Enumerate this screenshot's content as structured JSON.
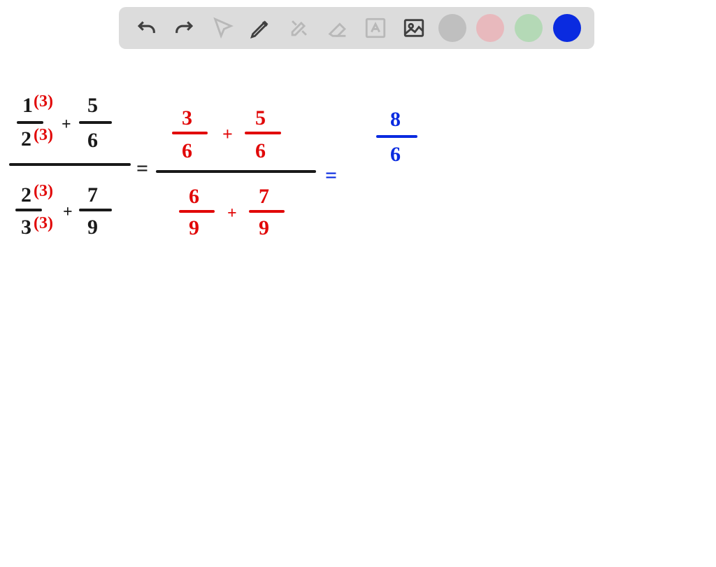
{
  "toolbar": {
    "tools": {
      "undo": "undo",
      "redo": "redo",
      "pointer": "pointer",
      "pen": "pen",
      "tools_disabled": "tools",
      "eraser": "eraser",
      "textbox": "text",
      "image": "image"
    },
    "colors": {
      "gray": "#bfbfbf",
      "pink": "#e8b9bd",
      "green": "#b4d9b6",
      "blue": "#0a2be0"
    }
  },
  "math": {
    "colors": {
      "black": "#1a1a1a",
      "red": "#e10808",
      "blue": "#0a2be0"
    },
    "step1": {
      "top": {
        "frac1": {
          "num": "1",
          "den": "2",
          "mult_num": "(3)",
          "mult_den": "(3)"
        },
        "plus": "+",
        "frac2": {
          "num": "5",
          "den": "6"
        }
      },
      "bottom": {
        "frac1": {
          "num": "2",
          "den": "3",
          "mult_num": "(3)",
          "mult_den": "(3)"
        },
        "plus": "+",
        "frac2": {
          "num": "7",
          "den": "9"
        }
      }
    },
    "eq1": "=",
    "step2": {
      "top": {
        "frac1": {
          "num": "3",
          "den": "6"
        },
        "plus": "+",
        "frac2": {
          "num": "5",
          "den": "6"
        }
      },
      "bottom": {
        "frac1": {
          "num": "6",
          "den": "9"
        },
        "plus": "+",
        "frac2": {
          "num": "7",
          "den": "9"
        }
      }
    },
    "eq2": "=",
    "step3": {
      "top": {
        "num": "8",
        "den": "6"
      }
    }
  }
}
